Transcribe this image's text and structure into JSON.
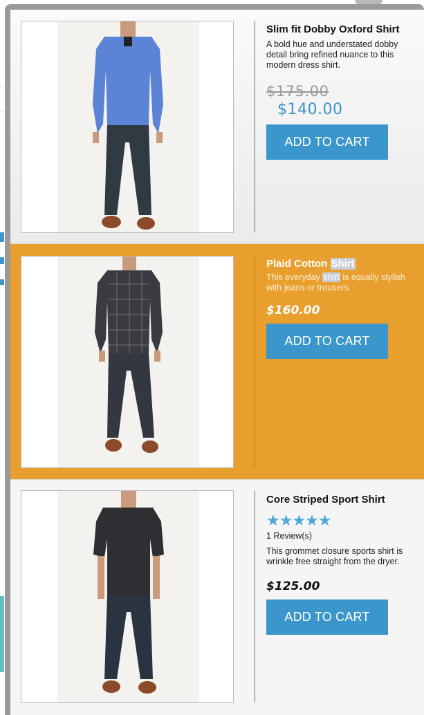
{
  "products": [
    {
      "title": "Slim fit Dobby Oxford Shirt",
      "description": "A bold hue and understated dobby detail bring refined nuance to this modern dress shirt.",
      "old_price": "$175.00",
      "price": "$140.00",
      "button_label": "ADD TO CART",
      "shirt_color": "#5b83d6",
      "pants_color": "#2f3a42"
    },
    {
      "title_before": "Plaid Cotton ",
      "title_highlight": "Shirt",
      "desc_before": "This everyday ",
      "desc_highlight": "shirt",
      "desc_after": " is equally stylish with jeans or trousers.",
      "price": "$160.00",
      "button_label": "ADD TO CART",
      "shirt_color": "#3a3b40",
      "pants_color": "#33373f"
    },
    {
      "title": "Core Striped Sport Shirt",
      "stars": "★★★★★",
      "reviews": "1 Review(s)",
      "description": "This grommet closure sports shirt is wrinkle free straight from the dryer.",
      "price": "$125.00",
      "button_label": "ADD TO CART",
      "shirt_color": "#2f2f33",
      "pants_color": "#2a3340"
    }
  ],
  "colors": {
    "highlight_bg": "#e89f2d",
    "button_bg": "#3a96cb",
    "sale_price": "#3a93c9",
    "star_color": "#4ba7d4"
  }
}
